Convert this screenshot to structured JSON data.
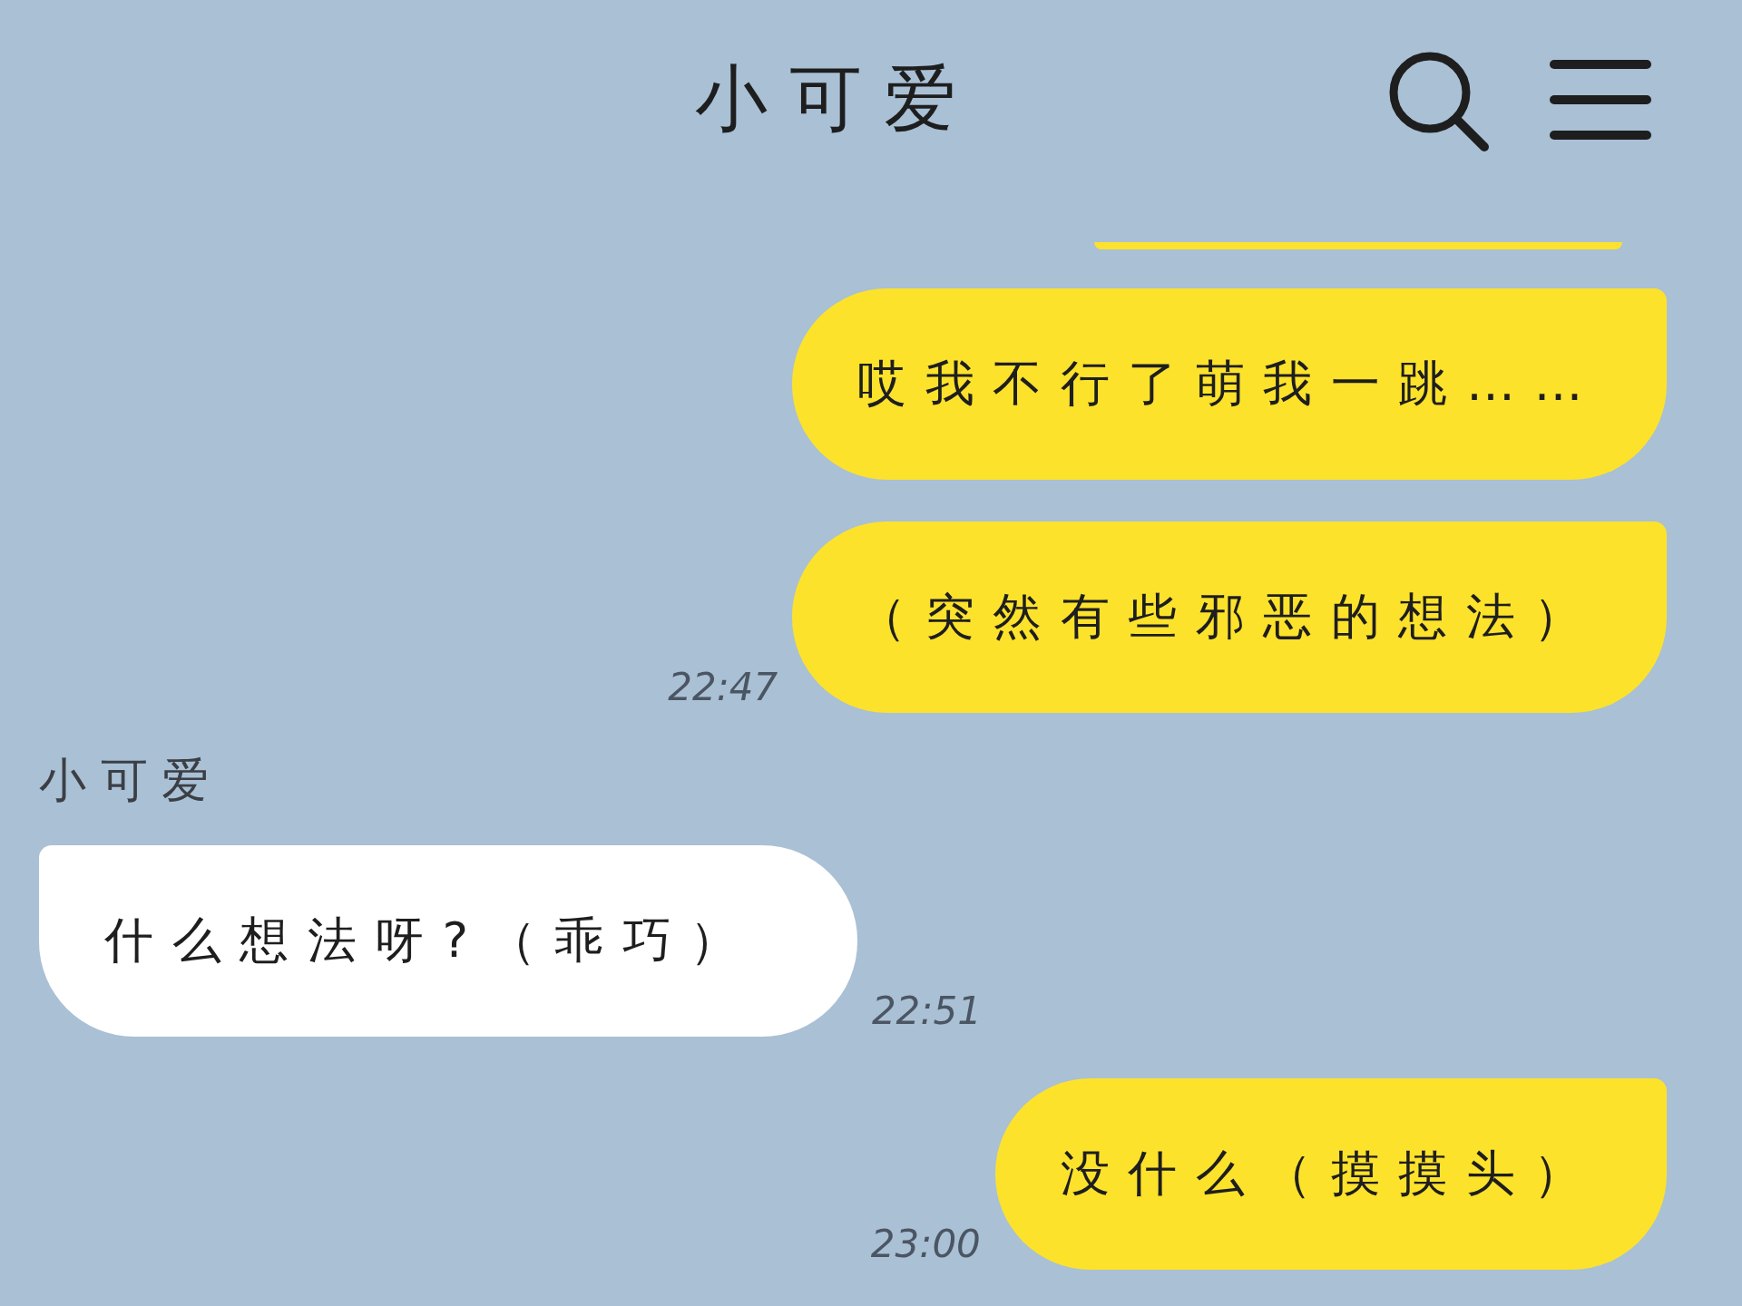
{
  "header": {
    "title": "小可爱"
  },
  "messages": [
    {
      "kind": "edge"
    },
    {
      "kind": "sent",
      "text": "哎我不行了萌我一跳……"
    },
    {
      "kind": "sent",
      "text": "（突然有些邪恶的想法）",
      "time": "22:47"
    },
    {
      "kind": "received",
      "sender": "小可爱",
      "text": "什么想法呀?（乖巧）",
      "time": "22:51"
    },
    {
      "kind": "sent",
      "text": "没什么（摸摸头）",
      "time": "23:00"
    }
  ]
}
